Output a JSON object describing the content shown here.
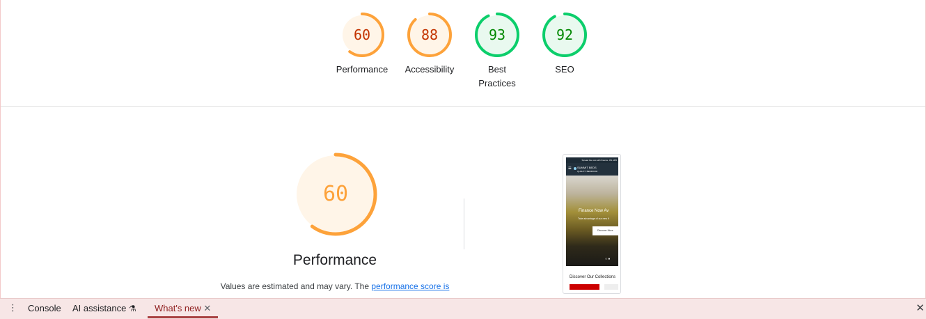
{
  "top_gauges": [
    {
      "score": "60",
      "label": "Performance",
      "fraction": 0.6,
      "color": "#fda23a",
      "textColor": "#c33300",
      "bg": "#fff5e8"
    },
    {
      "score": "88",
      "label": "Accessibility",
      "fraction": 0.88,
      "color": "#fda23a",
      "textColor": "#c33300",
      "bg": "#fff5e8"
    },
    {
      "score": "93",
      "label": "Best Practices",
      "fraction": 0.93,
      "color": "#0cce6b",
      "textColor": "#008800",
      "bg": "#e9f9ef"
    },
    {
      "score": "92",
      "label": "SEO",
      "fraction": 0.92,
      "color": "#0cce6b",
      "textColor": "#008800",
      "bg": "#e9f9ef"
    }
  ],
  "performance": {
    "score": "60",
    "fraction": 0.6,
    "color": "#fda23a",
    "bg": "#fff5e8",
    "title": "Performance",
    "desc_prefix": "Values are estimated and may vary. The ",
    "desc_link": "performance score is"
  },
  "screenshot": {
    "banner": "Spread the cost with finance. 0% APR",
    "brand": "SUMMIT BEDS",
    "brand_sub": "QUALITY BEDROOM",
    "hero_title": "Finance Now Av",
    "hero_sub": "Take advantage of our new fi",
    "hero_button": "Discover More",
    "collections": "Discover Our Collections"
  },
  "drawer": {
    "menu_icon": "kebab-menu-icon",
    "tabs": [
      {
        "label": "Console"
      },
      {
        "label": "AI assistance",
        "icon": "flask-icon"
      },
      {
        "label": "What's new",
        "active": true
      }
    ],
    "close_icon": "close-icon"
  }
}
